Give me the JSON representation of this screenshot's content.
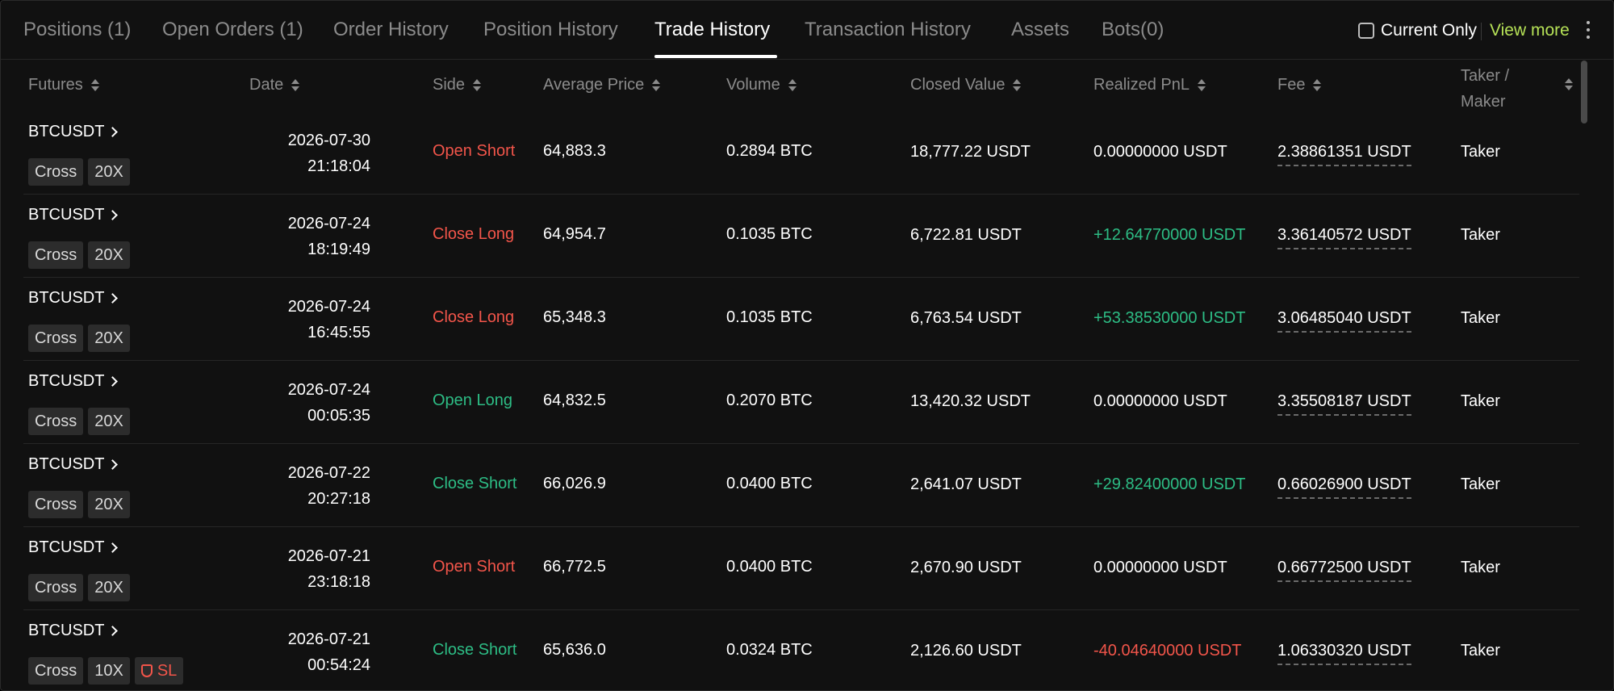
{
  "tabs": [
    {
      "label": "Positions (1)"
    },
    {
      "label": "Open Orders (1)"
    },
    {
      "label": "Order History"
    },
    {
      "label": "Position History"
    },
    {
      "label": "Trade History"
    },
    {
      "label": "Transaction History"
    },
    {
      "label": "Assets"
    },
    {
      "label": "Bots(0)"
    }
  ],
  "active_tab": "Trade History",
  "toolbar": {
    "current_only": "Current Only",
    "view_more": "View more"
  },
  "columns": {
    "futures": "Futures",
    "date": "Date",
    "side": "Side",
    "avg_price": "Average Price",
    "volume": "Volume",
    "closed_value": "Closed Value",
    "realized_pnl": "Realized PnL",
    "fee": "Fee",
    "taker_maker_1": "Taker /",
    "taker_maker_2": "Maker"
  },
  "rows": [
    {
      "symbol": "BTCUSDT",
      "margin": "Cross",
      "leverage": "20X",
      "date": "2026-07-30",
      "time": "21:18:04",
      "side": "Open Short",
      "avg_price": "64,883.3",
      "volume": "0.2894 BTC",
      "closed_value": "18,777.22  USDT",
      "pnl": "0.00000000  USDT",
      "fee": "2.38861351 USDT",
      "taker_maker": "Taker"
    },
    {
      "symbol": "BTCUSDT",
      "margin": "Cross",
      "leverage": "20X",
      "date": "2026-07-24",
      "time": "18:19:49",
      "side": "Close Long",
      "avg_price": "64,954.7",
      "volume": "0.1035 BTC",
      "closed_value": "6,722.81  USDT",
      "pnl": "+12.64770000  USDT",
      "fee": "3.36140572 USDT",
      "taker_maker": "Taker"
    },
    {
      "symbol": "BTCUSDT",
      "margin": "Cross",
      "leverage": "20X",
      "date": "2026-07-24",
      "time": "16:45:55",
      "side": "Close Long",
      "avg_price": "65,348.3",
      "volume": "0.1035 BTC",
      "closed_value": "6,763.54  USDT",
      "pnl": "+53.38530000  USDT",
      "fee": "3.06485040 USDT",
      "taker_maker": "Taker"
    },
    {
      "symbol": "BTCUSDT",
      "margin": "Cross",
      "leverage": "20X",
      "date": "2026-07-24",
      "time": "00:05:35",
      "side": "Open Long",
      "avg_price": "64,832.5",
      "volume": "0.2070 BTC",
      "closed_value": "13,420.32  USDT",
      "pnl": "0.00000000  USDT",
      "fee": "3.35508187 USDT",
      "taker_maker": "Taker"
    },
    {
      "symbol": "BTCUSDT",
      "margin": "Cross",
      "leverage": "20X",
      "date": "2026-07-22",
      "time": "20:27:18",
      "side": "Close Short",
      "avg_price": "66,026.9",
      "volume": "0.0400 BTC",
      "closed_value": "2,641.07  USDT",
      "pnl": "+29.82400000  USDT",
      "fee": "0.66026900 USDT",
      "taker_maker": "Taker"
    },
    {
      "symbol": "BTCUSDT",
      "margin": "Cross",
      "leverage": "20X",
      "date": "2026-07-21",
      "time": "23:18:18",
      "side": "Open Short",
      "avg_price": "66,772.5",
      "volume": "0.0400 BTC",
      "closed_value": "2,670.90  USDT",
      "pnl": "0.00000000  USDT",
      "fee": "0.66772500 USDT",
      "taker_maker": "Taker"
    },
    {
      "symbol": "BTCUSDT",
      "margin": "Cross",
      "leverage": "10X",
      "sl": "SL",
      "date": "2026-07-21",
      "time": "00:54:24",
      "side": "Close Short",
      "avg_price": "65,636.0",
      "volume": "0.0324 BTC",
      "closed_value": "2,126.60  USDT",
      "pnl": "-40.04640000  USDT",
      "fee": "1.06330320 USDT",
      "taker_maker": "Taker"
    }
  ],
  "colors": {
    "accent_green": "#b6e257",
    "profit": "#2dbd85",
    "loss": "#f2554a",
    "background": "#111111"
  }
}
